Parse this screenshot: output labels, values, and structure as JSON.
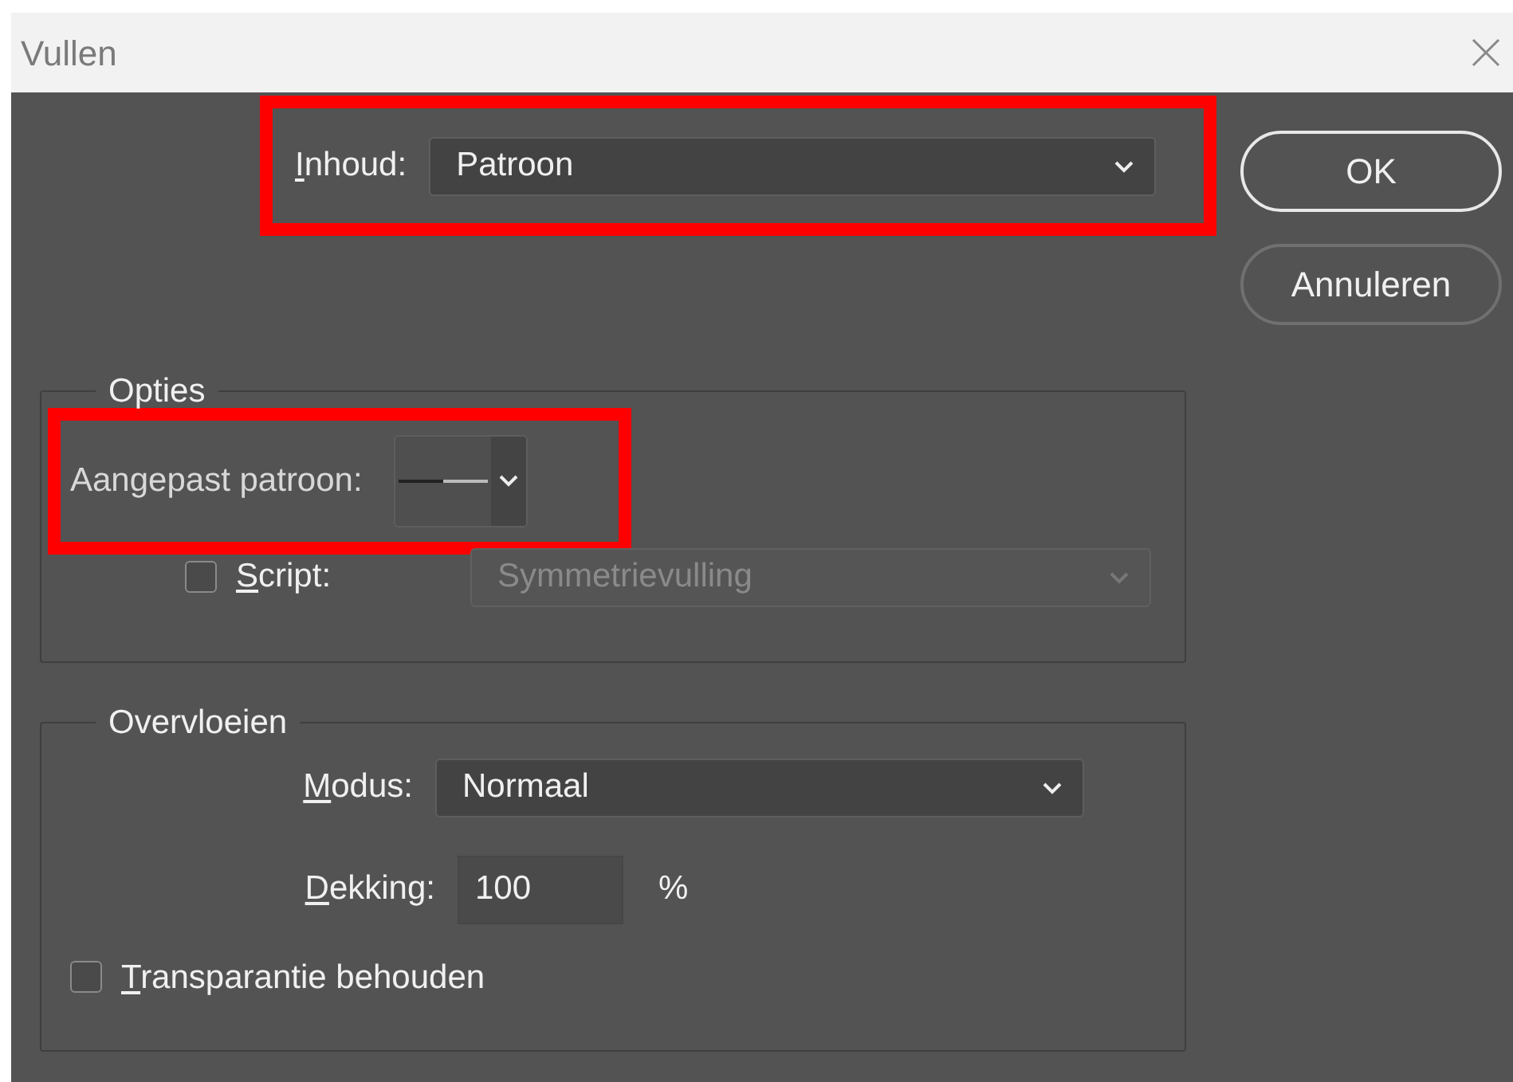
{
  "window": {
    "title": "Vullen"
  },
  "content": {
    "label": "Inhoud:",
    "underline_first": true,
    "value": "Patroon",
    "highlighted": true
  },
  "buttons": [
    {
      "label": "OK",
      "default": true
    },
    {
      "label": "Annuleren",
      "default": false
    }
  ],
  "options": {
    "legend": "Opties",
    "custom_pattern": {
      "label": "Aangepast patroon:",
      "underline_first": false,
      "highlighted": true
    },
    "script": {
      "label": "Script:",
      "underline_first": true,
      "checked": false,
      "value": "Symmetrievulling",
      "disabled": true
    }
  },
  "blending": {
    "legend": "Overvloeien",
    "mode": {
      "label": "Modus:",
      "underline_first": true,
      "value": "Normaal"
    },
    "opacity": {
      "label": "Dekking:",
      "underline_first": true,
      "value": "100",
      "unit": "%"
    },
    "preserve_transparency": {
      "label": "Transparantie behouden",
      "underline_first": true,
      "checked": false
    }
  }
}
